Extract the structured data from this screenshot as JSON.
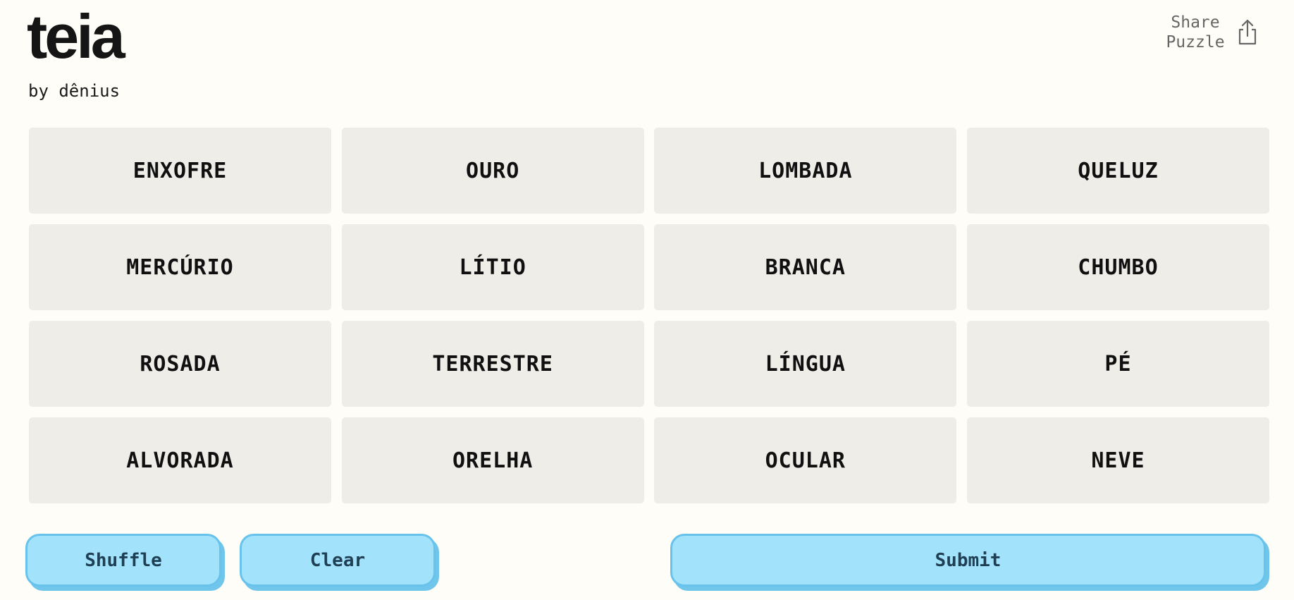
{
  "header": {
    "title": "teia",
    "byline": "by dênius",
    "share_label": "Share Puzzle",
    "share_icon": "share-icon"
  },
  "board": {
    "tiles": [
      "ENXOFRE",
      "OURO",
      "LOMBADA",
      "QUELUZ",
      "MERCÚRIO",
      "LÍTIO",
      "BRANCA",
      "CHUMBO",
      "ROSADA",
      "TERRESTRE",
      "LÍNGUA",
      "PÉ",
      "ALVORADA",
      "ORELHA",
      "OCULAR",
      "NEVE"
    ]
  },
  "controls": {
    "shuffle_label": "Shuffle",
    "clear_label": "Clear",
    "submit_label": "Submit"
  },
  "colors": {
    "background": "#fffdf8",
    "tile": "#efede8",
    "button": "#a3e2fb",
    "button_border": "#67c3ec",
    "button_text": "#1f3f55"
  }
}
